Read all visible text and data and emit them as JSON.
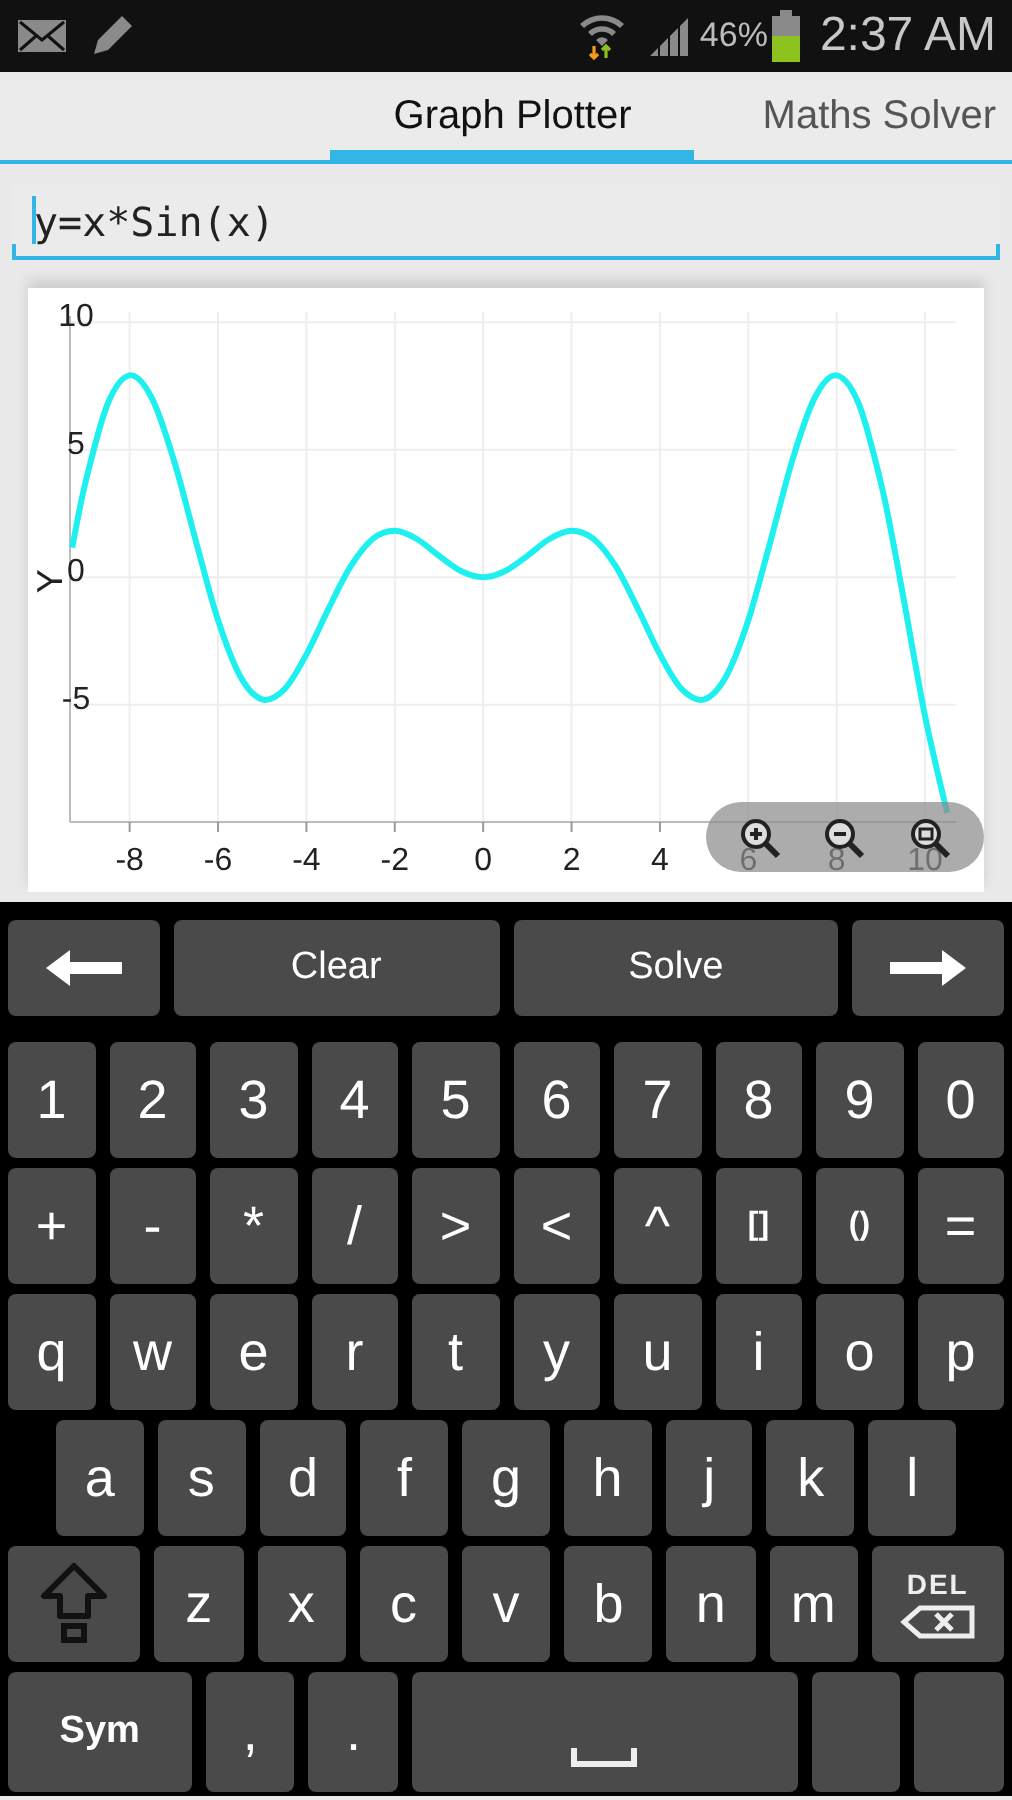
{
  "status_bar": {
    "battery": "46%",
    "time": "2:37 AM"
  },
  "tabs": [
    {
      "label": "Graph Plotter",
      "selected": true
    },
    {
      "label": "Maths Solver",
      "selected": false
    }
  ],
  "formula": {
    "value": "y=x*Sin(x)"
  },
  "graph": {
    "chart_data": {
      "type": "line",
      "grid": true,
      "ylabel": "Y",
      "xlim": [
        -9.35,
        10.7
      ],
      "ylim": [
        -9.6,
        10.4
      ],
      "xticks": [
        -8,
        -6,
        -4,
        -2,
        0,
        2,
        4,
        6,
        8,
        10
      ],
      "yticks": [
        -5,
        0,
        5,
        10
      ],
      "x": [
        -9.3,
        -9,
        -8.5,
        -8,
        -7.5,
        -7,
        -6.5,
        -6,
        -5.5,
        -5,
        -4.5,
        -4,
        -3.5,
        -3,
        -2.5,
        -2,
        -1.5,
        -1,
        -0.5,
        0,
        0.5,
        1,
        1.5,
        2,
        2.5,
        3,
        3.5,
        4,
        4.5,
        5,
        5.5,
        6,
        6.5,
        7,
        7.5,
        8,
        8.5,
        9,
        9.3,
        9.5,
        10,
        10.5
      ],
      "series": [
        {
          "color": "#1ef0f0",
          "values": [
            1.16,
            3.71,
            6.79,
            7.91,
            7.03,
            4.6,
            1.4,
            -1.68,
            -3.88,
            -4.79,
            -4.4,
            -3.03,
            -1.23,
            0.42,
            1.5,
            1.82,
            1.5,
            0.84,
            0.24,
            0,
            0.24,
            0.84,
            1.5,
            1.82,
            1.5,
            0.42,
            -1.23,
            -3.03,
            -4.4,
            -4.79,
            -3.88,
            -1.68,
            1.4,
            4.6,
            7.03,
            7.91,
            6.79,
            3.71,
            1.16,
            -0.71,
            -5.44,
            -9.24
          ]
        }
      ]
    }
  },
  "keyboard": [
    [
      {
        "kind": "arrow_left"
      },
      {
        "kind": "wide",
        "label": "Clear"
      },
      {
        "kind": "wide",
        "label": "Solve"
      },
      {
        "kind": "arrow_right"
      }
    ],
    [
      {
        "kind": "char",
        "label": "1"
      },
      {
        "kind": "char",
        "label": "2"
      },
      {
        "kind": "char",
        "label": "3"
      },
      {
        "kind": "char",
        "label": "4"
      },
      {
        "kind": "char",
        "label": "5"
      },
      {
        "kind": "char",
        "label": "6"
      },
      {
        "kind": "char",
        "label": "7"
      },
      {
        "kind": "char",
        "label": "8"
      },
      {
        "kind": "char",
        "label": "9"
      },
      {
        "kind": "char",
        "label": "0"
      }
    ],
    [
      {
        "kind": "char",
        "label": "+"
      },
      {
        "kind": "char",
        "label": "-"
      },
      {
        "kind": "char",
        "label": "*"
      },
      {
        "kind": "char",
        "label": "/"
      },
      {
        "kind": "char",
        "label": ">"
      },
      {
        "kind": "char",
        "label": "<"
      },
      {
        "kind": "char",
        "label": "^"
      },
      {
        "kind": "small",
        "label": "[]"
      },
      {
        "kind": "small",
        "label": "()"
      },
      {
        "kind": "char",
        "label": "="
      }
    ],
    [
      {
        "kind": "char",
        "label": "q"
      },
      {
        "kind": "char",
        "label": "w"
      },
      {
        "kind": "char",
        "label": "e"
      },
      {
        "kind": "char",
        "label": "r"
      },
      {
        "kind": "char",
        "label": "t"
      },
      {
        "kind": "char",
        "label": "y"
      },
      {
        "kind": "char",
        "label": "u"
      },
      {
        "kind": "char",
        "label": "i"
      },
      {
        "kind": "char",
        "label": "o"
      },
      {
        "kind": "char",
        "label": "p"
      }
    ],
    [
      {
        "kind": "char",
        "label": "a"
      },
      {
        "kind": "char",
        "label": "s"
      },
      {
        "kind": "char",
        "label": "d"
      },
      {
        "kind": "char",
        "label": "f"
      },
      {
        "kind": "char",
        "label": "g"
      },
      {
        "kind": "char",
        "label": "h"
      },
      {
        "kind": "char",
        "label": "j"
      },
      {
        "kind": "char",
        "label": "k"
      },
      {
        "kind": "char",
        "label": "l"
      }
    ],
    [
      {
        "kind": "shift"
      },
      {
        "kind": "char",
        "label": "z"
      },
      {
        "kind": "char",
        "label": "x"
      },
      {
        "kind": "char",
        "label": "c"
      },
      {
        "kind": "char",
        "label": "v"
      },
      {
        "kind": "char",
        "label": "b"
      },
      {
        "kind": "char",
        "label": "n"
      },
      {
        "kind": "char",
        "label": "m"
      },
      {
        "kind": "delete",
        "label": "DEL"
      }
    ],
    [
      {
        "kind": "sym",
        "label": "Sym"
      },
      {
        "kind": "char",
        "label": ","
      },
      {
        "kind": "char",
        "label": "."
      },
      {
        "kind": "space"
      },
      {
        "kind": "blank"
      },
      {
        "kind": "blank"
      }
    ]
  ]
}
